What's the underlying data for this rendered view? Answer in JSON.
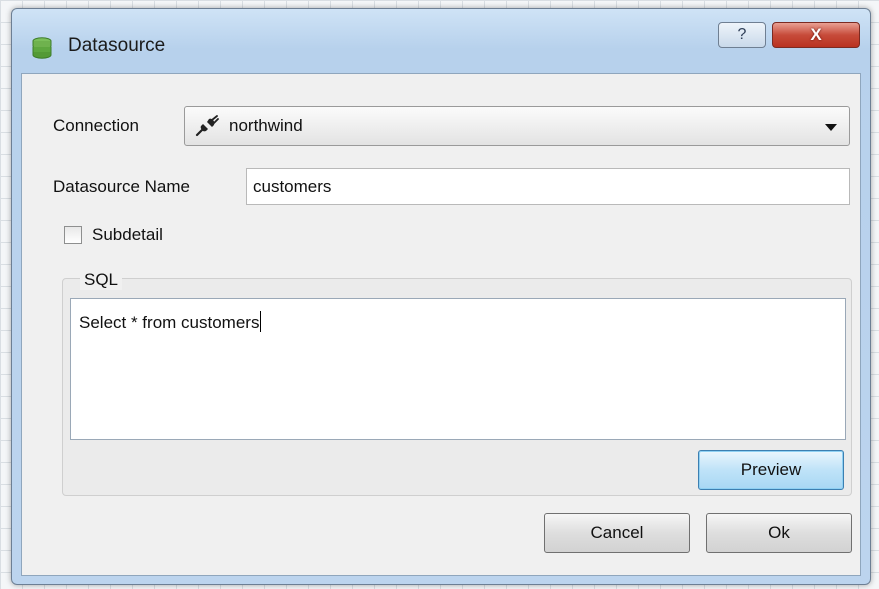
{
  "window": {
    "title": "Datasource",
    "title_icon": "database-icon",
    "help_glyph": "?",
    "close_glyph": "X"
  },
  "form": {
    "connection_label": "Connection",
    "connection_value": "northwind",
    "connection_icon": "plug-icon",
    "datasource_name_label": "Datasource Name",
    "datasource_name_value": "customers",
    "subdetail_label": "Subdetail",
    "subdetail_checked": false,
    "sql_group_title": "SQL",
    "sql_text": "Select * from customers"
  },
  "buttons": {
    "preview": "Preview",
    "cancel": "Cancel",
    "ok": "Ok"
  },
  "colors": {
    "close_button": "#c74b3a",
    "default_button_border": "#3c7fb1",
    "title_bar": "#b7d1ec"
  }
}
